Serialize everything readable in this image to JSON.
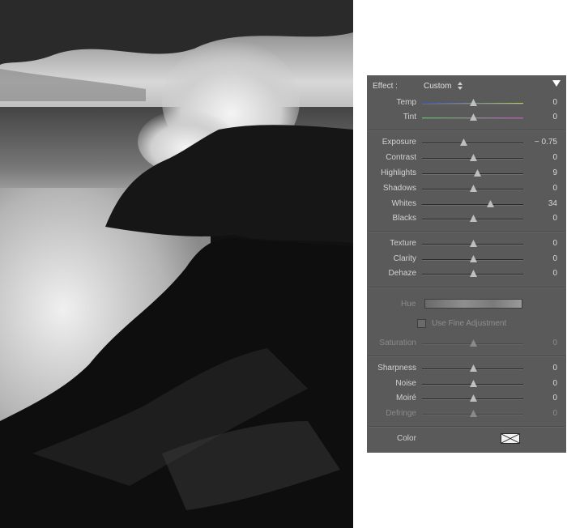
{
  "panel": {
    "effect_label": "Effect :",
    "effect_value": "Custom",
    "color_label": "Color",
    "hue_label": "Hue",
    "fine_adjustment_label": "Use Fine Adjustment",
    "fine_adjustment_checked": false
  },
  "sliders": {
    "temp": {
      "label": "Temp",
      "value": "0",
      "level": 0.5,
      "dim": false
    },
    "tint": {
      "label": "Tint",
      "value": "0",
      "level": 0.5,
      "dim": false
    },
    "exposure": {
      "label": "Exposure",
      "value": "− 0.75",
      "level": 0.41,
      "dim": false
    },
    "contrast": {
      "label": "Contrast",
      "value": "0",
      "level": 0.5,
      "dim": false
    },
    "highlights": {
      "label": "Highlights",
      "value": "9",
      "level": 0.54,
      "dim": false
    },
    "shadows": {
      "label": "Shadows",
      "value": "0",
      "level": 0.5,
      "dim": false
    },
    "whites": {
      "label": "Whites",
      "value": "34",
      "level": 0.67,
      "dim": false
    },
    "blacks": {
      "label": "Blacks",
      "value": "0",
      "level": 0.5,
      "dim": false
    },
    "texture": {
      "label": "Texture",
      "value": "0",
      "level": 0.5,
      "dim": false
    },
    "clarity": {
      "label": "Clarity",
      "value": "0",
      "level": 0.5,
      "dim": false
    },
    "dehaze": {
      "label": "Dehaze",
      "value": "0",
      "level": 0.5,
      "dim": false
    },
    "saturation": {
      "label": "Saturation",
      "value": "0",
      "level": 0.5,
      "dim": true
    },
    "sharpness": {
      "label": "Sharpness",
      "value": "0",
      "level": 0.5,
      "dim": false
    },
    "noise": {
      "label": "Noise",
      "value": "0",
      "level": 0.5,
      "dim": false
    },
    "moire": {
      "label": "Moiré",
      "value": "0",
      "level": 0.5,
      "dim": false
    },
    "defringe": {
      "label": "Defringe",
      "value": "0",
      "level": 0.5,
      "dim": true
    }
  },
  "colors": {
    "panel_bg": "#5a5a5a",
    "temp_track_left": "#3a4fd0",
    "temp_track_right": "#b6d35a",
    "tint_track_left": "#4fc25a",
    "tint_track_right": "#c04fc0"
  },
  "icons": {
    "effect_dropdown": "updown-arrows-icon",
    "collapse": "triangle-down-icon",
    "slider_thumb": "triangle-thumb-icon"
  }
}
